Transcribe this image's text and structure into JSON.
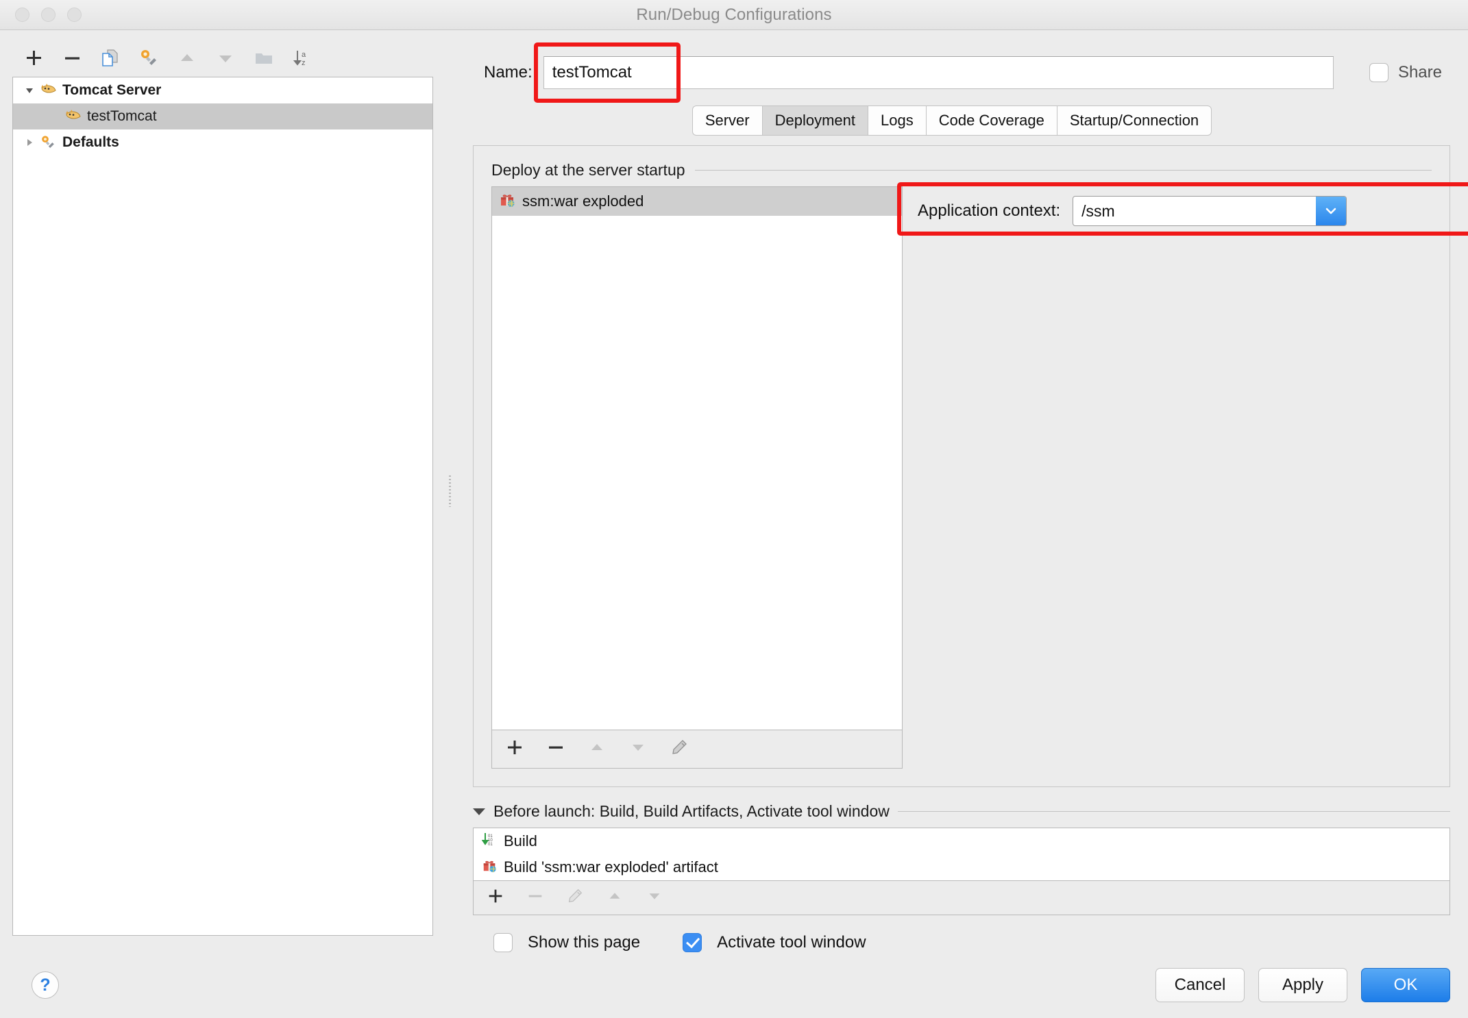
{
  "window": {
    "title": "Run/Debug Configurations",
    "traffic_lights": [
      "close",
      "minimize",
      "zoom"
    ]
  },
  "sidebar": {
    "toolbar": [
      {
        "name": "add-configuration-button",
        "icon": "plus-icon",
        "enabled": true
      },
      {
        "name": "remove-configuration-button",
        "icon": "minus-icon",
        "enabled": true
      },
      {
        "name": "copy-configuration-button",
        "icon": "copy-icon",
        "enabled": true
      },
      {
        "name": "edit-defaults-button",
        "icon": "wrench-icon",
        "enabled": true
      },
      {
        "name": "move-up-button",
        "icon": "arrow-up-icon",
        "enabled": false
      },
      {
        "name": "move-down-button",
        "icon": "arrow-down-icon",
        "enabled": false
      },
      {
        "name": "new-folder-button",
        "icon": "folder-icon",
        "enabled": false
      },
      {
        "name": "sort-configurations-button",
        "icon": "sort-az-icon",
        "enabled": true
      }
    ],
    "tree": [
      {
        "label": "Tomcat Server",
        "icon": "tomcat-icon",
        "expanded": true,
        "bold": true,
        "selected": false,
        "indent": false
      },
      {
        "label": "testTomcat",
        "icon": "tomcat-icon",
        "expanded": null,
        "bold": false,
        "selected": true,
        "indent": true
      },
      {
        "label": "Defaults",
        "icon": "wrench-icon",
        "expanded": false,
        "bold": true,
        "selected": false,
        "indent": false
      }
    ]
  },
  "header": {
    "name_label": "Name:",
    "name_value": "testTomcat",
    "share_label": "Share",
    "share_checked": false
  },
  "tabs": [
    {
      "label": "Server",
      "active": false
    },
    {
      "label": "Deployment",
      "active": true
    },
    {
      "label": "Logs",
      "active": false
    },
    {
      "label": "Code Coverage",
      "active": false
    },
    {
      "label": "Startup/Connection",
      "active": false
    }
  ],
  "deployment": {
    "section_title": "Deploy at the server startup",
    "artifacts": [
      {
        "label": "ssm:war exploded",
        "icon": "artifact-icon",
        "selected": true
      }
    ],
    "list_toolbar": [
      {
        "name": "add-artifact-button",
        "icon": "plus-icon",
        "enabled": true
      },
      {
        "name": "remove-artifact-button",
        "icon": "minus-icon",
        "enabled": true
      },
      {
        "name": "move-artifact-up-button",
        "icon": "arrow-up-icon",
        "enabled": false
      },
      {
        "name": "move-artifact-down-button",
        "icon": "arrow-down-icon",
        "enabled": false
      },
      {
        "name": "edit-artifact-button",
        "icon": "pencil-icon",
        "enabled": true
      }
    ],
    "application_context_label": "Application context:",
    "application_context_value": "/ssm"
  },
  "before_launch": {
    "header": "Before launch: Build, Build Artifacts, Activate tool window",
    "tasks": [
      {
        "label": "Build",
        "icon": "compile-icon"
      },
      {
        "label": "Build 'ssm:war exploded' artifact",
        "icon": "artifact-icon"
      }
    ],
    "toolbar": [
      {
        "name": "add-task-button",
        "icon": "plus-icon",
        "enabled": true
      },
      {
        "name": "remove-task-button",
        "icon": "minus-icon",
        "enabled": false
      },
      {
        "name": "edit-task-button",
        "icon": "pencil-icon",
        "enabled": false
      },
      {
        "name": "move-task-up-button",
        "icon": "arrow-up-icon",
        "enabled": false
      },
      {
        "name": "move-task-down-button",
        "icon": "arrow-down-icon",
        "enabled": false
      }
    ],
    "options": [
      {
        "label": "Show this page",
        "checked": false
      },
      {
        "label": "Activate tool window",
        "checked": true
      }
    ]
  },
  "footer": {
    "help_label": "?",
    "cancel_label": "Cancel",
    "apply_label": "Apply",
    "ok_label": "OK"
  },
  "annotations": {
    "color": "#f01818",
    "boxes": [
      "name-field-highlight",
      "application-context-highlight"
    ]
  }
}
